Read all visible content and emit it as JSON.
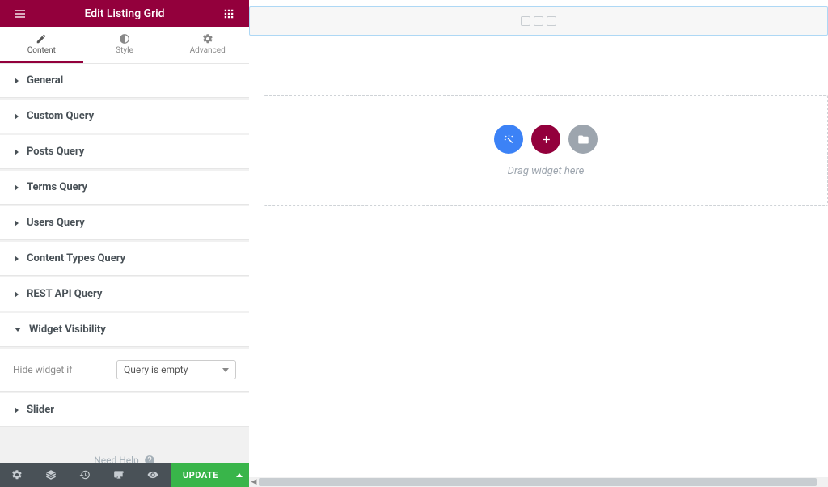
{
  "header": {
    "title": "Edit Listing Grid"
  },
  "tabs": {
    "content": "Content",
    "style": "Style",
    "advanced": "Advanced"
  },
  "sections": {
    "general": "General",
    "custom_query": "Custom Query",
    "posts_query": "Posts Query",
    "terms_query": "Terms Query",
    "users_query": "Users Query",
    "content_types_query": "Content Types Query",
    "rest_api_query": "REST API Query",
    "widget_visibility": "Widget Visibility",
    "slider": "Slider"
  },
  "visibility": {
    "hide_label": "Hide widget if",
    "selected": "Query is empty"
  },
  "help": {
    "label": "Need Help"
  },
  "footer": {
    "update": "UPDATE"
  },
  "canvas": {
    "drop_hint": "Drag widget here"
  },
  "colors": {
    "accent": "#93003c",
    "green": "#39b54a",
    "blue": "#3c82f6"
  }
}
